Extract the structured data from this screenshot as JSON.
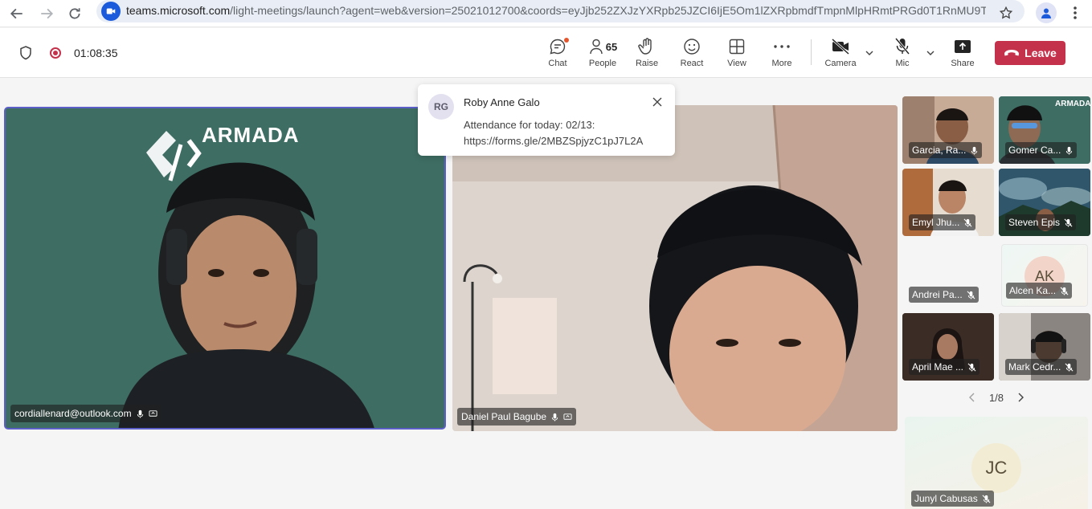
{
  "browser": {
    "url_host": "teams.microsoft.com",
    "url_rest": "/light-meetings/launch?agent=web&version=25021012700&coords=eyJjb252ZXJzYXRpb25JZCI6IjE5Om1lZXRpbmdfTmpnMlpHRmtPRGd0T1RnMU9T..."
  },
  "toolbar": {
    "timer": "01:08:35",
    "chat_label": "Chat",
    "people_label": "People",
    "people_count": "65",
    "raise_label": "Raise",
    "react_label": "React",
    "view_label": "View",
    "more_label": "More",
    "camera_label": "Camera",
    "mic_label": "Mic",
    "share_label": "Share",
    "leave_label": "Leave"
  },
  "notification": {
    "initials": "RG",
    "sender": "Roby Anne Galo",
    "message": "Attendance for today: 02/13: https://forms.gle/2MBZSpjyzC1pJ7L2A"
  },
  "main_videos": [
    {
      "name": "cordiallenard@outlook.com"
    },
    {
      "name": "Daniel Paul Bagube"
    }
  ],
  "brand_text": "ARMADA",
  "side_tiles": [
    {
      "name": "Garcia, Ra..."
    },
    {
      "name": "Gomer Ca..."
    },
    {
      "name": "Emyl Jhu..."
    },
    {
      "name": "Steven Epis"
    },
    {
      "name": "Andrei Pa..."
    },
    {
      "name": "Alcen Ka...",
      "initials": "AK"
    },
    {
      "name": "April Mae ..."
    },
    {
      "name": "Mark Cedr..."
    }
  ],
  "pager": {
    "label": "1/8"
  },
  "self_tile": {
    "name": "Junyl Cabusas",
    "initials": "JC"
  },
  "colors": {
    "leave": "#c4314b",
    "active_speaker": "#5b5fc7",
    "recording": "#c4314b"
  }
}
